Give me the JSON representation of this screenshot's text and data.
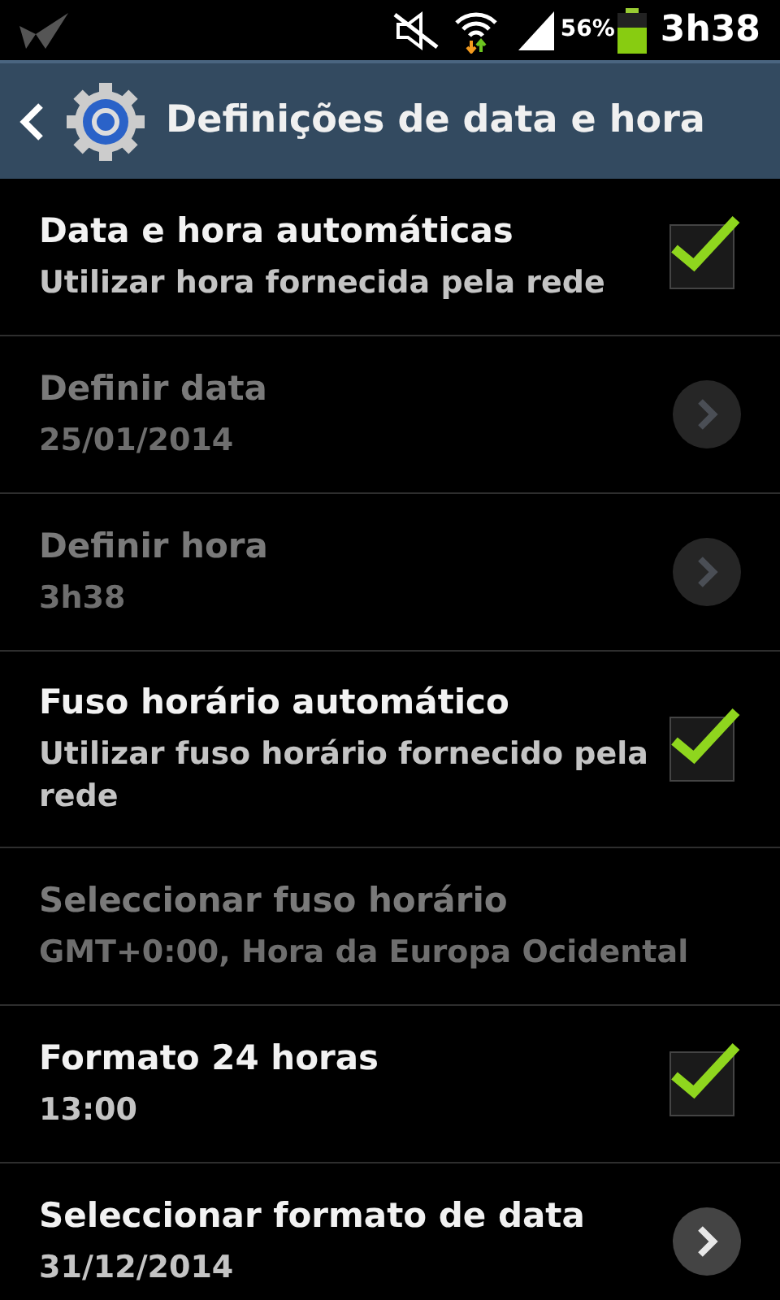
{
  "status_bar": {
    "battery": "56%",
    "time": "3h38"
  },
  "header": {
    "title": "Definições de data e hora"
  },
  "settings": [
    {
      "kind": "checkbox",
      "title": "Data e hora automáticas",
      "summary": "Utilizar hora fornecida pela rede",
      "checked": true,
      "disabled": false
    },
    {
      "kind": "arrow",
      "title": "Definir data",
      "summary": "25/01/2014",
      "disabled": true
    },
    {
      "kind": "arrow",
      "title": "Definir hora",
      "summary": "3h38",
      "disabled": true
    },
    {
      "kind": "checkbox",
      "title": "Fuso horário automático",
      "summary": "Utilizar fuso horário fornecido pela rede",
      "checked": true,
      "disabled": false
    },
    {
      "kind": "plain",
      "title": "Seleccionar fuso horário",
      "summary": "GMT+0:00, Hora da Europa Ocidental",
      "disabled": true
    },
    {
      "kind": "checkbox",
      "title": "Formato 24 horas",
      "summary": "13:00",
      "checked": true,
      "disabled": false
    },
    {
      "kind": "arrow",
      "title": "Seleccionar formato de data",
      "summary": "31/12/2014",
      "disabled": false
    }
  ]
}
